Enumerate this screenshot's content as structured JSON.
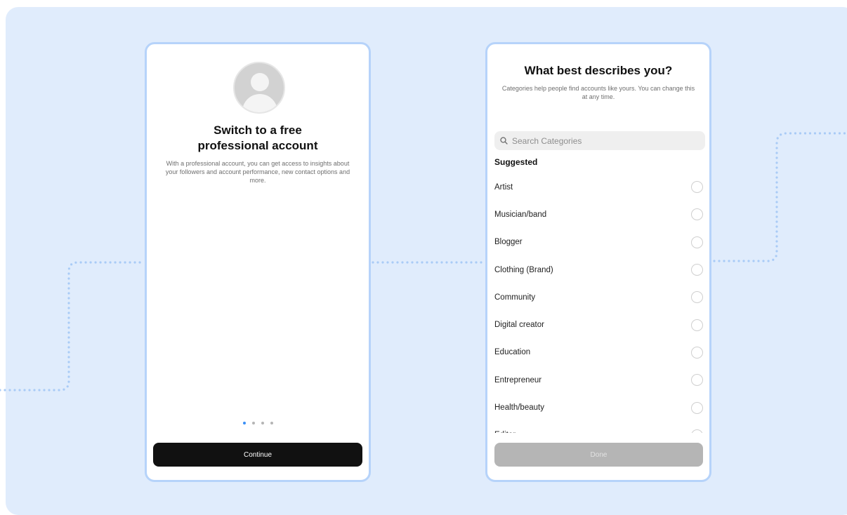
{
  "screen_left": {
    "avatar_icon": "default-avatar",
    "title": "Switch to a free professional account",
    "description": "With a professional account, you can get access to insights about your followers and account performance, new contact options and more.",
    "pager": {
      "total": 4,
      "active_index": 0
    },
    "continue_label": "Continue"
  },
  "screen_right": {
    "title": "What best describes you?",
    "description": "Categories help people find accounts like yours. You can change this at any time.",
    "search": {
      "placeholder": "Search Categories",
      "icon": "search-icon"
    },
    "suggested_label": "Suggested",
    "categories": [
      {
        "label": "Artist"
      },
      {
        "label": "Musician/band"
      },
      {
        "label": "Blogger"
      },
      {
        "label": "Clothing (Brand)"
      },
      {
        "label": "Community"
      },
      {
        "label": "Digital creator"
      },
      {
        "label": "Education"
      },
      {
        "label": "Entrepreneur"
      },
      {
        "label": "Health/beauty"
      },
      {
        "label": "Editor"
      }
    ],
    "done_label": "Done"
  },
  "colors": {
    "background": "#e0ecfc",
    "phone_border": "#b6d3fa",
    "connector_dots": "#a9cbf6",
    "pager_active": "#3a8ff5",
    "continue_button": "#111111",
    "done_button_disabled": "#b5b5b5"
  }
}
